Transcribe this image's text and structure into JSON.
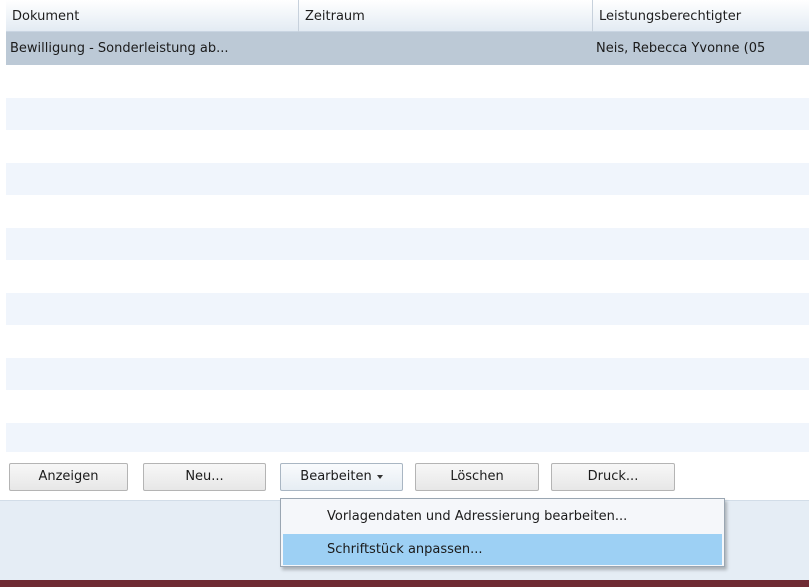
{
  "table": {
    "columns": [
      "Dokument",
      "Zeitraum",
      "Leistungsberechtigter"
    ],
    "rows": [
      {
        "dokument": "Bewilligung - Sonderleistung ab...",
        "zeitraum": "",
        "leistungsberechtigter": "Neis, Rebecca Yvonne (05"
      }
    ]
  },
  "toolbar": {
    "show_label": "Anzeigen",
    "new_label": "Neu...",
    "edit_label": "Bearbeiten",
    "delete_label": "Löschen",
    "print_label": "Druck..."
  },
  "edit_menu": {
    "items": [
      "Vorlagendaten und Adressierung bearbeiten...",
      "Schriftstück anpassen..."
    ],
    "highlighted_index": 1
  },
  "icons": {
    "edit_dropdown": "chevron-down-icon"
  },
  "colors": {
    "selected_row": "#bcc9d6",
    "alt_row": "#f0f5fc",
    "menu_highlight": "#9dd0f4",
    "status_area": "#e5edf5",
    "bottom_strip": "#6f2b34"
  }
}
